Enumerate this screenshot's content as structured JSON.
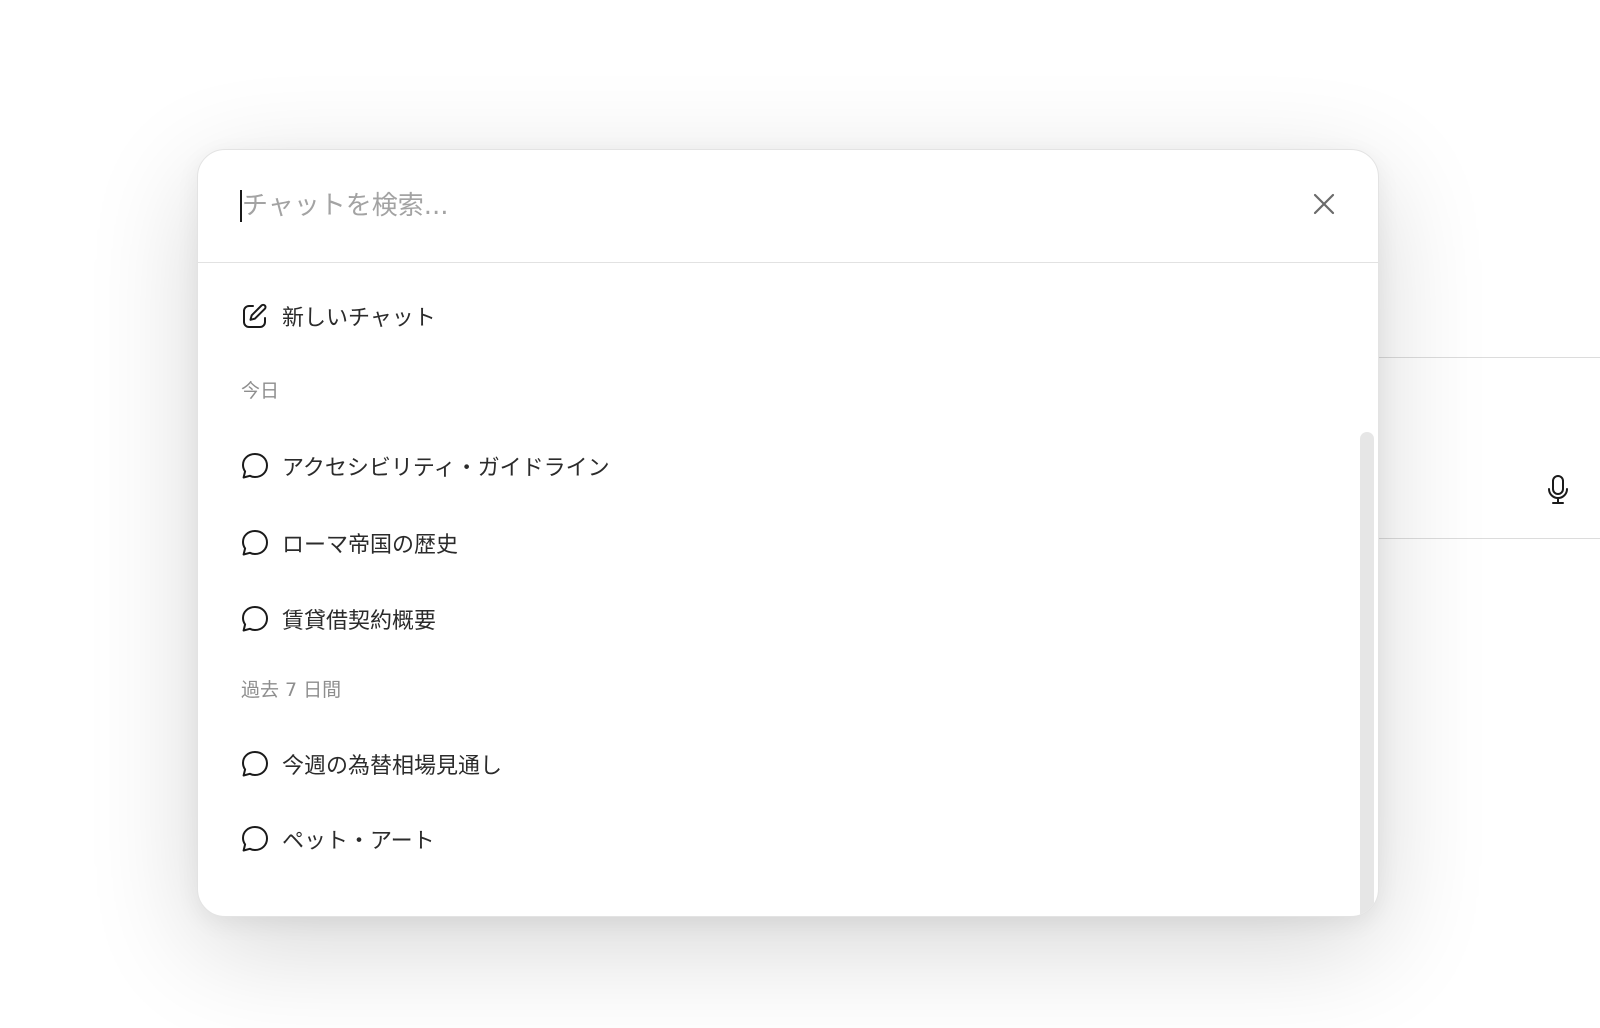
{
  "search": {
    "placeholder": "チャットを検索...",
    "value": ""
  },
  "actions": {
    "new_chat_label": "新しいチャット"
  },
  "sections": {
    "today": {
      "title": "今日",
      "items": [
        "アクセシビリティ・ガイドライン",
        "ローマ帝国の歴史",
        "賃貸借契約概要"
      ]
    },
    "past_7_days": {
      "title": "過去 7 日間",
      "items": [
        "今週の為替相場見通し",
        "ペット・アート"
      ]
    }
  },
  "icons": {
    "close": "close-icon",
    "new_chat": "edit-icon",
    "chat": "chat-bubble-icon",
    "microphone": "microphone-icon"
  }
}
